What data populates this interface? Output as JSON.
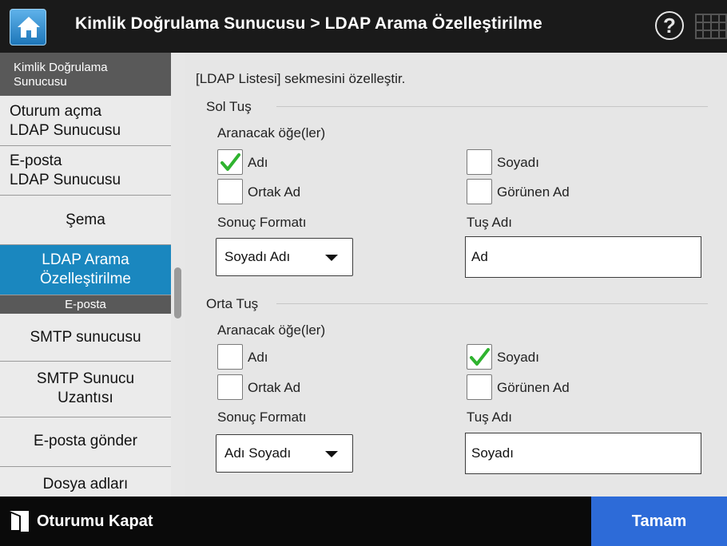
{
  "header": {
    "title": "Kimlik Doğrulama Sunucusu > LDAP Arama Özelleştirilme",
    "home_icon": "home-icon",
    "help_glyph": "?",
    "help_icon": "help-icon",
    "keyboard_icon": "keyboard-icon"
  },
  "sidebar": {
    "section_auth": "Kimlik Doğrulama Sunucusu",
    "items": [
      {
        "line1": "Oturum açma",
        "line2": "LDAP Sunucusu"
      },
      {
        "line1": "E-posta",
        "line2": "LDAP Sunucusu"
      },
      {
        "line1": "Şema",
        "line2": ""
      },
      {
        "line1": "LDAP Arama",
        "line2": "Özelleştirilme"
      },
      {
        "line1": "SMTP sunucusu",
        "line2": ""
      },
      {
        "line1": "SMTP Sunucu",
        "line2": "Uzantısı"
      },
      {
        "line1": "E-posta gönder",
        "line2": ""
      },
      {
        "line1": "Dosya adları",
        "line2": ""
      }
    ],
    "section_email": "E-posta",
    "active_color": "#1a87bf"
  },
  "content": {
    "intro": "[LDAP Listesi] sekmesini özelleştir.",
    "left_key": {
      "title": "Sol Tuş",
      "search_items_label": "Aranacak öğe(ler)",
      "checkboxes": [
        {
          "label": "Adı",
          "checked": true
        },
        {
          "label": "Soyadı",
          "checked": false
        },
        {
          "label": "Ortak Ad",
          "checked": false
        },
        {
          "label": "Görünen Ad",
          "checked": false
        }
      ],
      "result_format_label": "Sonuç Formatı",
      "result_format_value": "Soyadı Adı",
      "key_name_label": "Tuş Adı",
      "key_name_value": "Ad"
    },
    "middle_key": {
      "title": "Orta Tuş",
      "search_items_label": "Aranacak öğe(ler)",
      "checkboxes": [
        {
          "label": "Adı",
          "checked": false
        },
        {
          "label": "Soyadı",
          "checked": true
        },
        {
          "label": "Ortak Ad",
          "checked": false
        },
        {
          "label": "Görünen Ad",
          "checked": false
        }
      ],
      "result_format_label": "Sonuç Formatı",
      "result_format_value": "Adı Soyadı",
      "key_name_label": "Tuş Adı",
      "key_name_value": "Soyadı"
    }
  },
  "footer": {
    "logout_label": "Oturumu Kapat",
    "logout_icon": "logout-door-icon",
    "ok_label": "Tamam",
    "ok_color": "#2d6bd8"
  }
}
